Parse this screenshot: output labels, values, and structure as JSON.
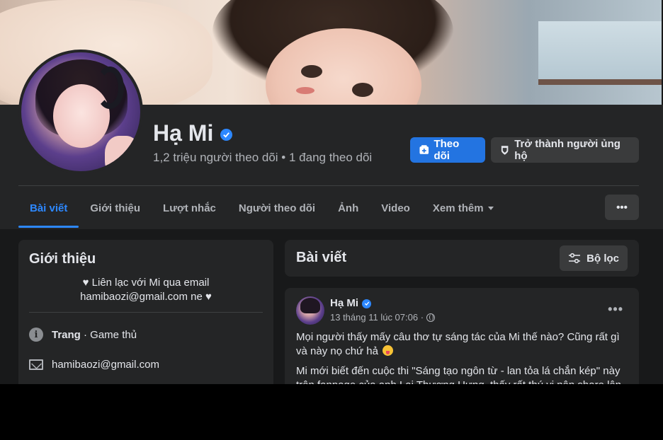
{
  "profile": {
    "name": "Hạ Mi",
    "followers_text": "1,2 triệu người theo dõi • 1 đang theo dõi"
  },
  "actions": {
    "follow_label": "Theo dõi",
    "support_label": "Trở thành người ủng hộ",
    "more_label": "•••"
  },
  "tabs": [
    {
      "label": "Bài viết",
      "active": true
    },
    {
      "label": "Giới thiệu"
    },
    {
      "label": "Lượt nhắc"
    },
    {
      "label": "Người theo dõi"
    },
    {
      "label": "Ảnh"
    },
    {
      "label": "Video"
    },
    {
      "label": "Xem thêm"
    }
  ],
  "intro": {
    "title": "Giới thiệu",
    "bio_line1": "♥ Liên lạc với Mi qua email",
    "bio_line2": "hamibaozi@gmail.com ne ♥",
    "page_label": "Trang",
    "page_category": " · Game thủ",
    "email": "hamibaozi@gmail.com"
  },
  "posts": {
    "title": "Bài viết",
    "filter_label": "Bộ lọc",
    "items": [
      {
        "author": "Hạ Mi",
        "time": "13 tháng 11 lúc 07:06 ·",
        "dots": "•••",
        "text1": "Mọi người thấy mấy câu thơ tự sáng tác của Mi thế nào? Cũng rất gì và này nọ chứ hả",
        "text2": "Mi mới biết đến cuộc thi \"Sáng tạo ngôn từ - lan tỏa lá chắn kép\" này trên fanpage của anh Lại Thương Hưng, thấy rất thú vị nên share lên"
      }
    ]
  },
  "colors": {
    "accent": "#2d88ff",
    "follow_button": "#2374e1",
    "background": "#18191a",
    "card": "#242526"
  }
}
